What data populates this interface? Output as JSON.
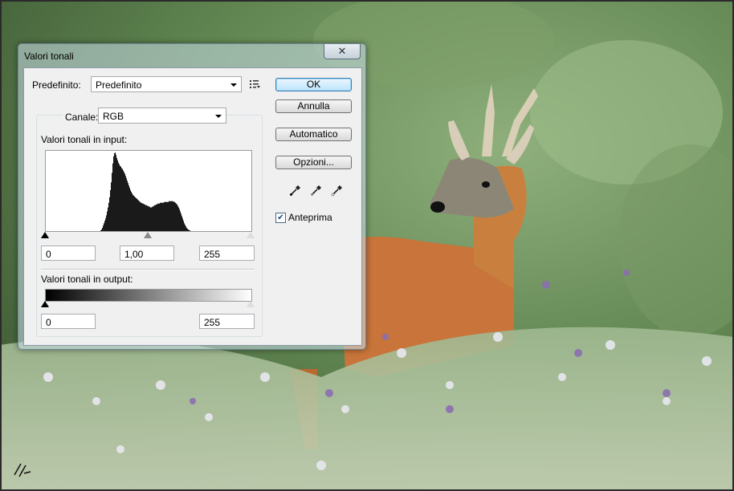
{
  "dialog": {
    "title": "Valori tonali",
    "close_glyph": "✕",
    "preset_label": "Predefinito:",
    "preset_value": "Predefinito",
    "preset_menu_icon": "list-menu-icon",
    "channel_label": "Canale:",
    "channel_value": "RGB",
    "input_levels_label": "Valori tonali in input:",
    "input_black": "0",
    "input_gamma": "1,00",
    "input_white": "255",
    "output_levels_label": "Valori tonali in output:",
    "output_black": "0",
    "output_white": "255",
    "buttons": {
      "ok": "OK",
      "cancel": "Annulla",
      "auto": "Automatico",
      "options": "Opzioni..."
    },
    "eyedroppers": [
      "black-eyedropper-icon",
      "gray-eyedropper-icon",
      "white-eyedropper-icon"
    ],
    "preview_label": "Anteprima",
    "preview_checked": true,
    "histogram": {
      "bins": [
        0,
        0,
        0,
        0,
        0,
        0,
        0,
        0,
        0,
        0,
        0,
        0,
        0,
        0,
        0,
        0,
        0,
        0,
        0,
        0,
        0,
        0,
        0,
        0,
        0,
        0,
        0,
        0,
        0,
        0,
        0,
        0,
        0,
        0,
        0,
        0,
        0,
        0,
        0,
        0,
        0,
        0,
        0,
        0,
        0,
        0,
        0,
        0,
        0,
        0,
        0,
        0,
        0,
        0,
        0,
        0,
        0,
        0,
        0,
        0,
        0,
        0,
        0,
        0,
        0,
        0,
        0,
        0,
        0.01,
        0.02,
        0.04,
        0.07,
        0.1,
        0.13,
        0.16,
        0.2,
        0.25,
        0.3,
        0.36,
        0.43,
        0.52,
        0.62,
        0.74,
        0.86,
        0.95,
        0.99,
        1,
        0.97,
        0.93,
        0.9,
        0.87,
        0.85,
        0.83,
        0.82,
        0.8,
        0.79,
        0.77,
        0.75,
        0.73,
        0.7,
        0.67,
        0.64,
        0.61,
        0.58,
        0.55,
        0.52,
        0.5,
        0.48,
        0.46,
        0.45,
        0.44,
        0.43,
        0.42,
        0.41,
        0.4,
        0.39,
        0.38,
        0.37,
        0.36,
        0.36,
        0.35,
        0.35,
        0.34,
        0.34,
        0.33,
        0.33,
        0.32,
        0.32,
        0.31,
        0.31,
        0.3,
        0.3,
        0.31,
        0.31,
        0.32,
        0.33,
        0.33,
        0.34,
        0.34,
        0.35,
        0.35,
        0.35,
        0.36,
        0.36,
        0.36,
        0.36,
        0.36,
        0.37,
        0.37,
        0.37,
        0.37,
        0.37,
        0.37,
        0.38,
        0.38,
        0.38,
        0.38,
        0.38,
        0.38,
        0.37,
        0.37,
        0.36,
        0.35,
        0.34,
        0.32,
        0.3,
        0.28,
        0.25,
        0.22,
        0.19,
        0.16,
        0.13,
        0.1,
        0.08,
        0.06,
        0.04,
        0.03,
        0.02,
        0.01,
        0.01,
        0,
        0,
        0,
        0,
        0,
        0,
        0,
        0,
        0,
        0,
        0,
        0,
        0,
        0,
        0,
        0,
        0,
        0,
        0,
        0,
        0,
        0,
        0,
        0,
        0,
        0,
        0,
        0,
        0,
        0,
        0,
        0,
        0,
        0,
        0,
        0,
        0,
        0,
        0,
        0,
        0,
        0,
        0,
        0,
        0,
        0,
        0,
        0,
        0,
        0,
        0,
        0,
        0,
        0,
        0,
        0,
        0,
        0,
        0,
        0,
        0,
        0,
        0,
        0,
        0,
        0,
        0,
        0,
        0,
        0,
        0,
        0,
        0,
        0,
        0,
        0,
        0,
        0,
        0,
        0,
        0,
        0,
        0,
        0,
        0,
        0,
        0,
        0,
        0,
        0,
        0,
        0,
        0,
        0,
        0
      ]
    }
  },
  "colors": {
    "background_photo": "#5a7a4a",
    "deer": "#c8743a",
    "default_button": "#bee6fd"
  }
}
